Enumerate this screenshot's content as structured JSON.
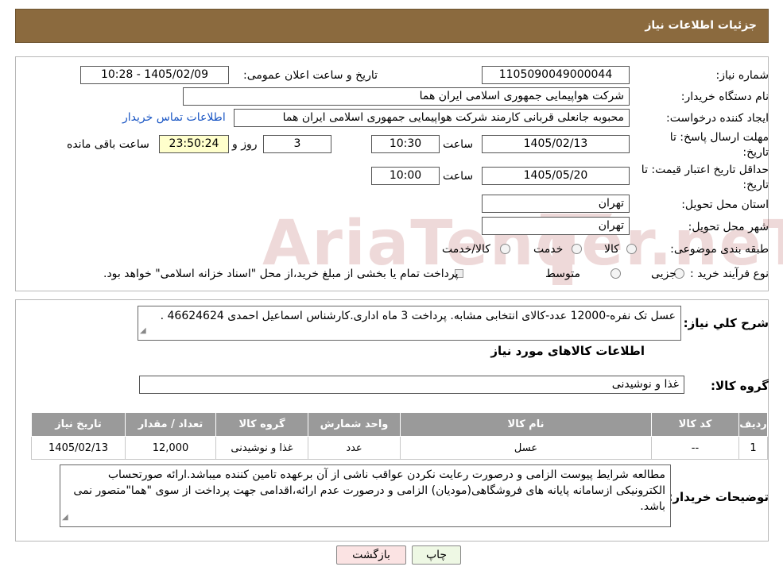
{
  "header": {
    "title": "جزئیات اطلاعات نیاز"
  },
  "form": {
    "need_number_label": "شماره نیاز:",
    "need_number": "1105090049000044",
    "announce_label": "تاریخ و ساعت اعلان عمومی:",
    "announce_value": "1405/02/09 - 10:28",
    "buyer_org_label": "نام دستگاه خریدار:",
    "buyer_org": "شرکت هواپیمایی جمهوری اسلامی ایران هما",
    "creator_label": "ایجاد کننده درخواست:",
    "creator": "محبوبه جانعلی قربانی کارمند شرکت هواپیمایی جمهوری اسلامی ایران هما",
    "contact_link": "اطلاعات تماس خریدار",
    "deadline_label_1": "مهلت ارسال پاسخ: تا",
    "deadline_label_2": "تاریخ:",
    "deadline_date": "1405/02/13",
    "time_word": "ساعت",
    "deadline_time": "10:30",
    "days_value": "3",
    "days_word": "روز و",
    "remaining_value": "23:50:24",
    "remaining_word": "ساعت باقی مانده",
    "validity_label_1": "حداقل تاریخ اعتبار قیمت: تا",
    "validity_label_2": "تاریخ:",
    "validity_date": "1405/05/20",
    "validity_time": "10:00",
    "province_label": "استان محل تحویل:",
    "province": "تهران",
    "city_label": "شهر محل تحویل:",
    "city": "تهران",
    "category_label": "طبقه بندی موضوعی:",
    "category_options": [
      "کالا",
      "خدمت",
      "کالا/خدمت"
    ],
    "process_label": "نوع فرآیند خرید :",
    "process_options": [
      "جزیی",
      "متوسط"
    ],
    "process_note": "پرداخت تمام یا بخشی از مبلغ خرید،از محل \"اسناد خزانه اسلامی\" خواهد بود."
  },
  "summary": {
    "label": "شرح کلي نياز:",
    "text": "عسل تک نفره-12000 عدد-کالای انتخابی مشابه. پرداخت 3 ماه اداری.کارشناس اسماعیل احمدی 46624624 ."
  },
  "goods": {
    "section_title": "اطلاعات کالاهای مورد نیاز",
    "group_label": "گروه کالا:",
    "group_value": "غذا و نوشیدنی",
    "columns": [
      "ردیف",
      "کد کالا",
      "نام کالا",
      "واحد شمارش",
      "گروه کالا",
      "تعداد / مقدار",
      "تاریخ نیاز"
    ],
    "rows": [
      [
        "1",
        "--",
        "عسل",
        "عدد",
        "غذا و نوشیدنی",
        "12,000",
        "1405/02/13"
      ]
    ]
  },
  "buyer_notes": {
    "label": "توضیحات خریدار:",
    "text": "مطالعه شرایط پیوست الزامی و درصورت رعایت نکردن عواقب ناشی از آن برعهده تامین کننده میباشد.ارائه صورتحساب الکترونیکی ازسامانه پایانه های فروشگاهی(مودیان) الزامی و درصورت عدم ارائه،اقدامی جهت پرداخت از سوی \"هما\"متصور نمی باشد."
  },
  "buttons": {
    "print": "چاپ",
    "back": "بازگشت"
  },
  "colors": {
    "header": "#8b6a3e",
    "table_header": "#9a9a9a",
    "link": "#1a56c4",
    "remaining_bg": "#ffffcc"
  },
  "watermark": {
    "text": "AriaTender.neT"
  }
}
